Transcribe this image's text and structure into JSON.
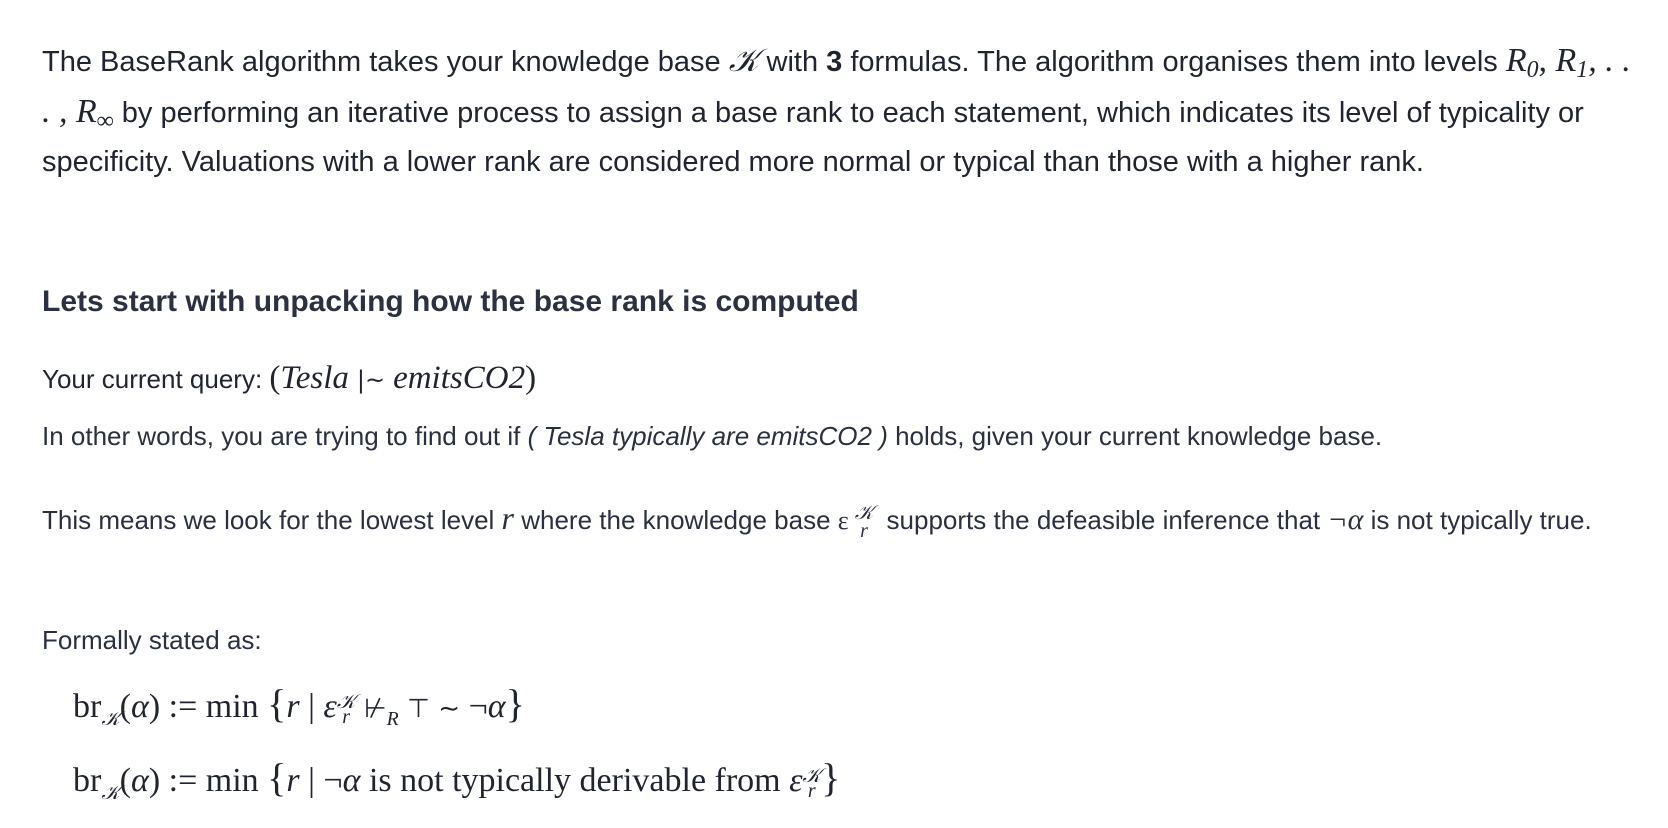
{
  "intro": {
    "t1": "The BaseRank algorithm takes your knowledge base ",
    "kb_symbol": "𝒦",
    "t2": " with ",
    "formula_count": "3",
    "t3": " formulas. The algorithm organises them into levels ",
    "levels_math": "R",
    "t4": " by performing an iterative process to assign a base rank to each statement, which indicates its level of typicality or specificity. Valuations with a lower rank are considered more normal or typical than those with a higher rank."
  },
  "heading": "Lets start with unpacking how the base rank is computed",
  "query": {
    "label": "Your current query: ",
    "antecedent": "Tesla",
    "turnstile": "|~",
    "consequent": "emitsCO2"
  },
  "other_words": {
    "t1": "In other words, you are trying to find out if ",
    "phrase": "( Tesla typically are emitsCO2 )",
    "t2": " holds, given your current knowledge base."
  },
  "means": {
    "t1": "This means we look for the lowest level ",
    "var": "r",
    "t2": " where the knowledge base ",
    "eps": "ε",
    "sup": "𝒦",
    "sub": "r",
    "t3": " supports the defeasible inference that ",
    "neg_alpha": "¬α",
    "t4": " is not typically true."
  },
  "formal_label": "Formally stated as:",
  "formula2_text": "is not typically derivable from"
}
